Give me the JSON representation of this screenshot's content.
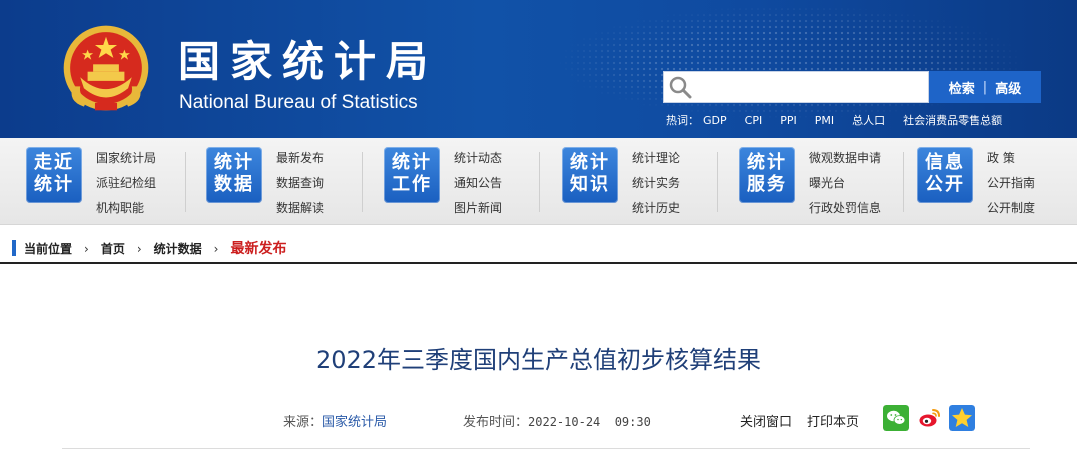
{
  "header": {
    "title_cn": "国家统计局",
    "title_en": "National Bureau of Statistics",
    "search": {
      "placeholder": "",
      "button_label": "检索",
      "advanced_label": "高级"
    },
    "hotwords_label": "热词：",
    "hotwords": [
      "GDP",
      "CPI",
      "PPI",
      "PMI",
      "总人口",
      "社会消费品零售总额"
    ]
  },
  "nav": [
    {
      "badge_line1": "走近",
      "badge_line2": "统计",
      "links": [
        "国家统计局",
        "派驻纪检组",
        "机构职能"
      ]
    },
    {
      "badge_line1": "统计",
      "badge_line2": "数据",
      "links": [
        "最新发布",
        "数据查询",
        "数据解读"
      ]
    },
    {
      "badge_line1": "统计",
      "badge_line2": "工作",
      "links": [
        "统计动态",
        "通知公告",
        "图片新闻"
      ]
    },
    {
      "badge_line1": "统计",
      "badge_line2": "知识",
      "links": [
        "统计理论",
        "统计实务",
        "统计历史"
      ]
    },
    {
      "badge_line1": "统计",
      "badge_line2": "服务",
      "links": [
        "微观数据申请",
        "曝光台",
        "行政处罚信息"
      ]
    },
    {
      "badge_line1": "信息",
      "badge_line2": "公开",
      "links": [
        "政  策",
        "公开指南",
        "公开制度"
      ]
    }
  ],
  "breadcrumb": {
    "label": "当前位置",
    "items": [
      "首页",
      "统计数据"
    ],
    "current": "最新发布",
    "separator": "›"
  },
  "article": {
    "title": "2022年三季度国内生产总值初步核算结果",
    "source_label": "来源：",
    "source": "国家统计局",
    "date_label": "发布时间：",
    "date": "2022-10-24  09:30",
    "close_label": "关闭窗口",
    "print_label": "打印本页"
  },
  "icons": [
    "emblem-icon",
    "search-icon",
    "wechat-share-icon",
    "weibo-share-icon",
    "favorite-star-icon"
  ],
  "colors": {
    "banner": "#1152a8",
    "nav_badge": "#1a5fc0",
    "breadcrumb_current": "#cc1f1f",
    "title": "#1f3f78"
  }
}
